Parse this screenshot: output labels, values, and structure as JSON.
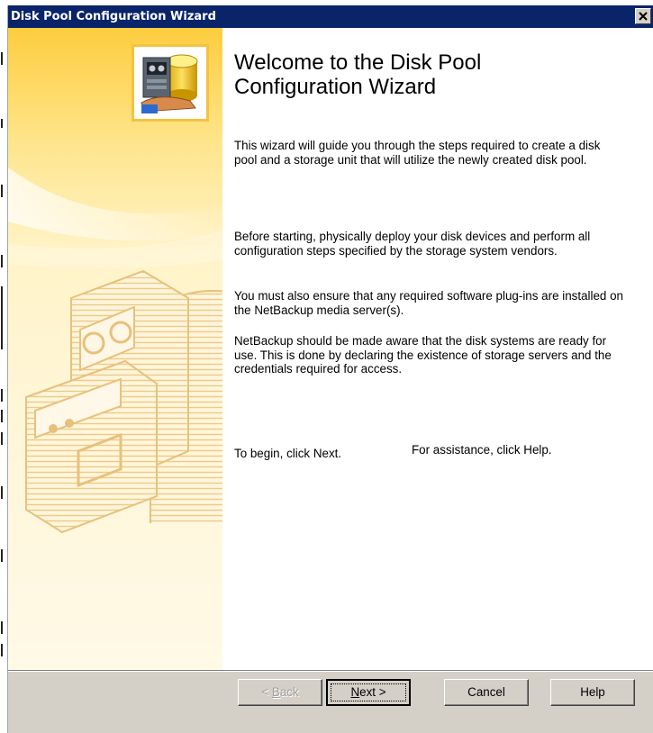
{
  "window": {
    "title": "Disk Pool Configuration Wizard"
  },
  "header": {
    "heading": "Welcome to the Disk Pool Configuration Wizard"
  },
  "body": {
    "paragraphs": [
      "This wizard will guide you through the steps required to create a disk pool and a storage unit that will utilize the newly created disk pool.",
      "Before starting, physically deploy your disk devices and perform all configuration steps specified by the storage system vendors.",
      "You must also ensure that any required software plug-ins are installed on the NetBackup media server(s).",
      "NetBackup should be made aware that the disk systems are ready for use. This is done by declaring the existence of storage servers and the credentials required for access."
    ],
    "begin_text": "To begin, click Next.",
    "assist_text": "For assistance, click Help."
  },
  "buttons": {
    "back": {
      "pre": "< ",
      "mnemonic": "B",
      "post": "ack"
    },
    "next": {
      "mnemonic": "N",
      "post": "ext >"
    },
    "cancel": "Cancel",
    "help": "Help"
  },
  "icons": {
    "close": "close-icon",
    "wizard": "disk-pool-wizard-icon",
    "watermark": "storage-server-watermark-icon"
  },
  "colors": {
    "title_bar": "#0a246a",
    "panel_gradient": "#fcd65a",
    "dialog_bg": "#d4d0c8"
  }
}
